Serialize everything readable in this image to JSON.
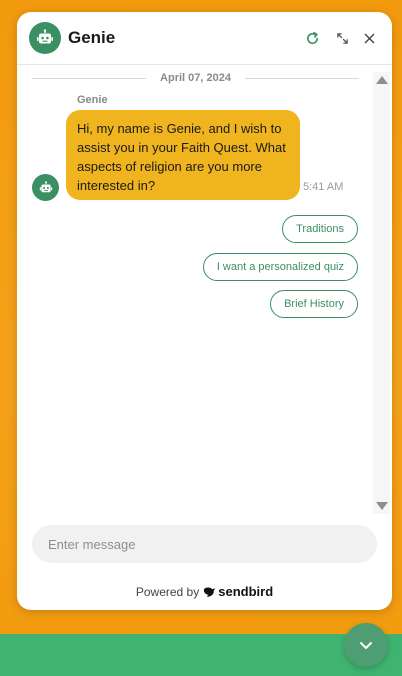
{
  "header": {
    "title": "Genie",
    "avatar_icon": "robot-icon",
    "refresh_icon": "refresh-icon",
    "expand_icon": "expand-icon",
    "close_icon": "close-icon"
  },
  "conversation": {
    "date": "April 07, 2024",
    "messages": [
      {
        "sender": "Genie",
        "text": "Hi, my name is Genie, and I wish to assist you in your Faith Quest. What aspects of religion are you more interested in?",
        "time": "5:41 AM"
      }
    ],
    "suggestions": [
      "Traditions",
      "I want a personalized quiz",
      "Brief History"
    ]
  },
  "composer": {
    "placeholder": "Enter message"
  },
  "footer": {
    "powered_by": "Powered by",
    "brand": "sendbird"
  },
  "colors": {
    "accent": "#3a8f63",
    "bubble": "#f0b41e",
    "background": "#f29a0e",
    "bottom_bar": "#3fb36f"
  }
}
